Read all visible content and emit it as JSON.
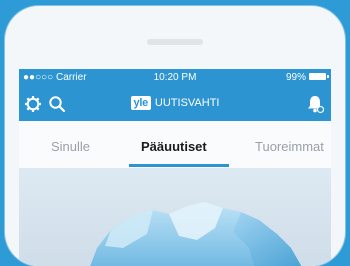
{
  "status_bar": {
    "carrier": "●●○○○ Carrier",
    "time": "10:20 PM",
    "battery_percent": "99%"
  },
  "navbar": {
    "logo_badge": "yle",
    "app_name": "UUTISVAHTI",
    "icons": [
      "gear-icon",
      "search-icon",
      "bell-icon"
    ]
  },
  "tabs": [
    {
      "label": "Sinulle",
      "active": false
    },
    {
      "label": "Pääuutiset",
      "active": true
    },
    {
      "label": "Tuoreimmat",
      "active": false
    }
  ],
  "colors": {
    "background": "#2e9bd6",
    "brand_blue": "#2d94d2",
    "active_tab_text": "#1c1c1c",
    "inactive_tab_text": "#9aa0a5"
  }
}
